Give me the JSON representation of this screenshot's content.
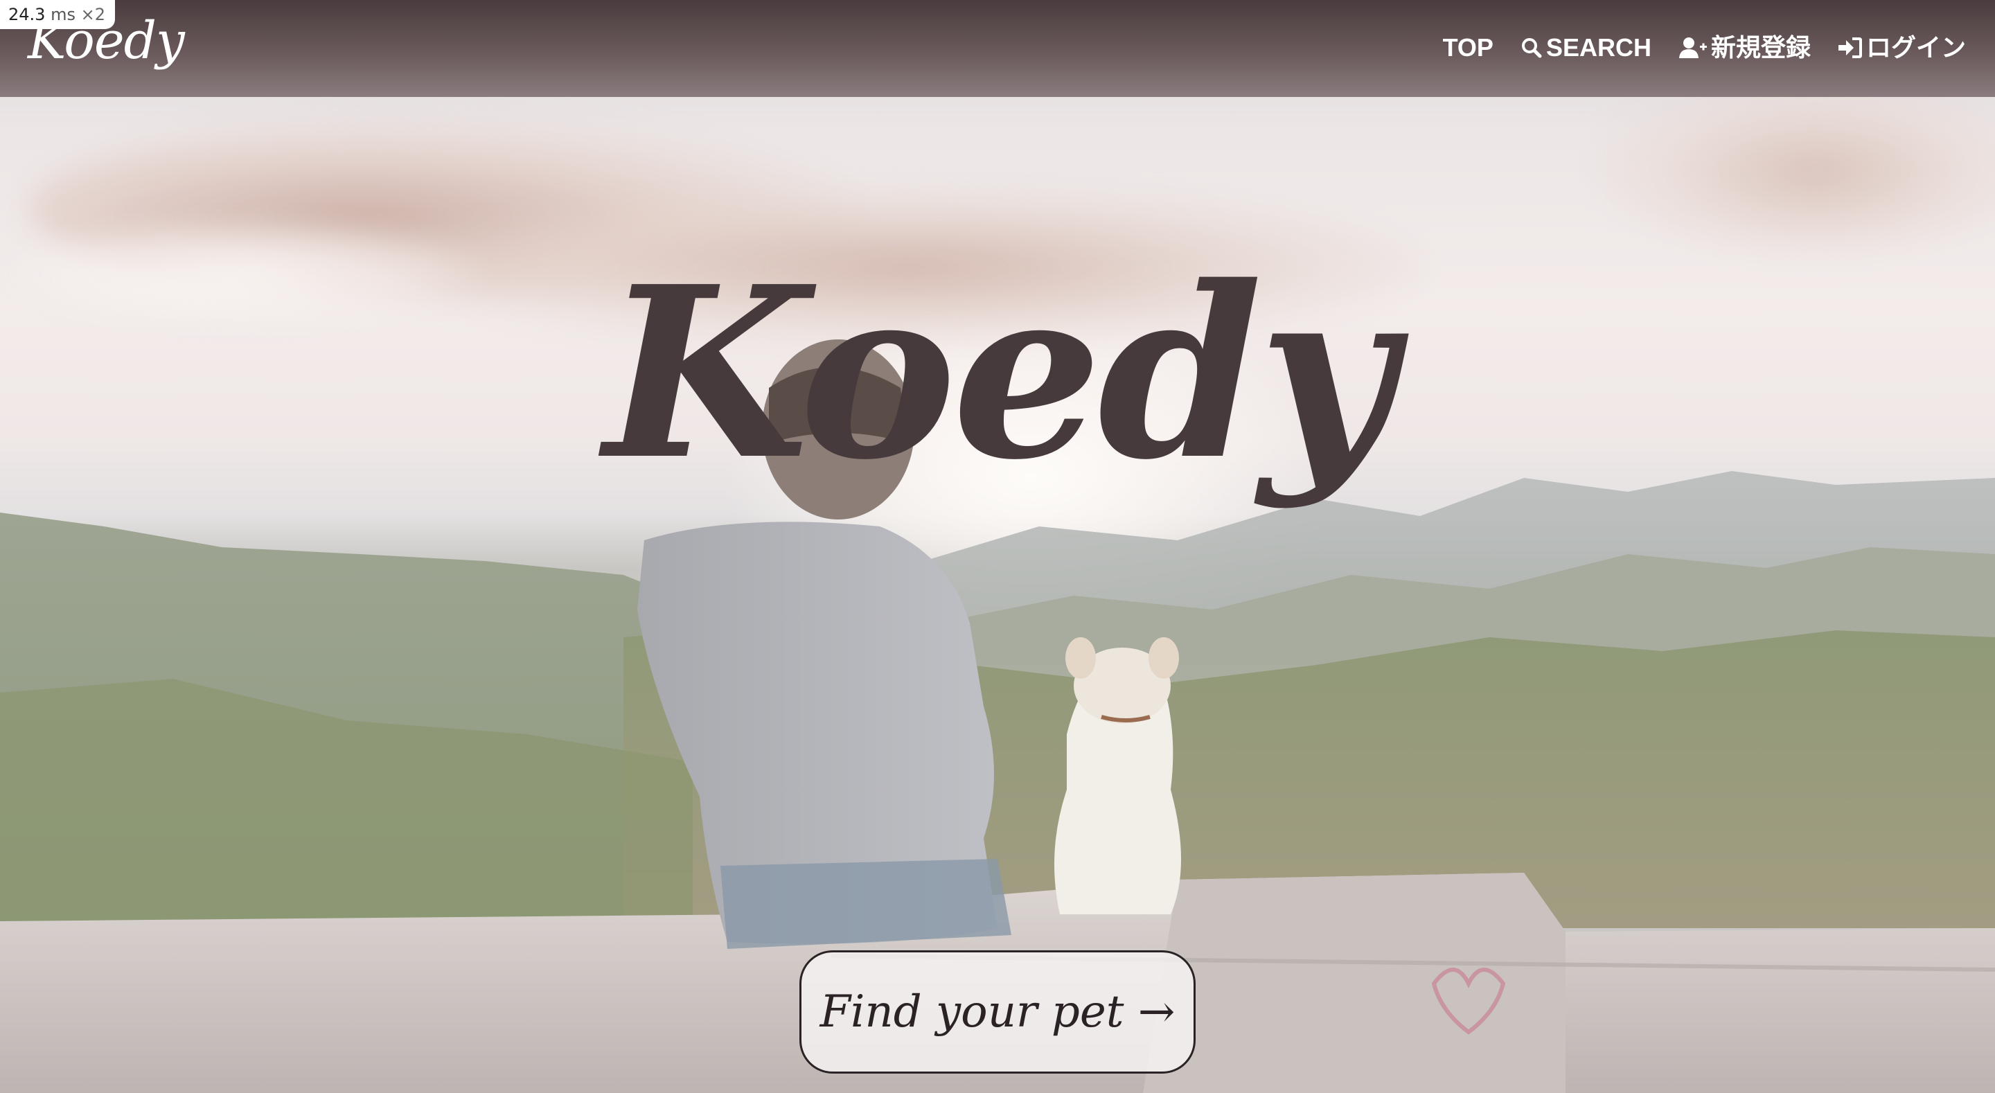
{
  "perf": {
    "value": "24.3",
    "unit": "ms",
    "multiplier": "×2"
  },
  "navbar": {
    "logo": "Koedy",
    "links": [
      {
        "label": "TOP",
        "icon": "none"
      },
      {
        "label": "SEARCH",
        "icon": "search-icon"
      },
      {
        "label": "新規登録",
        "icon": "user-plus-icon"
      },
      {
        "label": "ログイン",
        "icon": "sign-in-icon"
      }
    ]
  },
  "hero": {
    "title": "Koedy",
    "cta_label": "Find your pet →",
    "background": "photo-man-and-dog-on-mountain-overlook"
  },
  "colors": {
    "navbar_top": "#4a3c3e",
    "navbar_bottom": "#8a7c7e",
    "title": "#463a3c",
    "text_light": "#ffffff",
    "button_border": "#2a2224"
  }
}
